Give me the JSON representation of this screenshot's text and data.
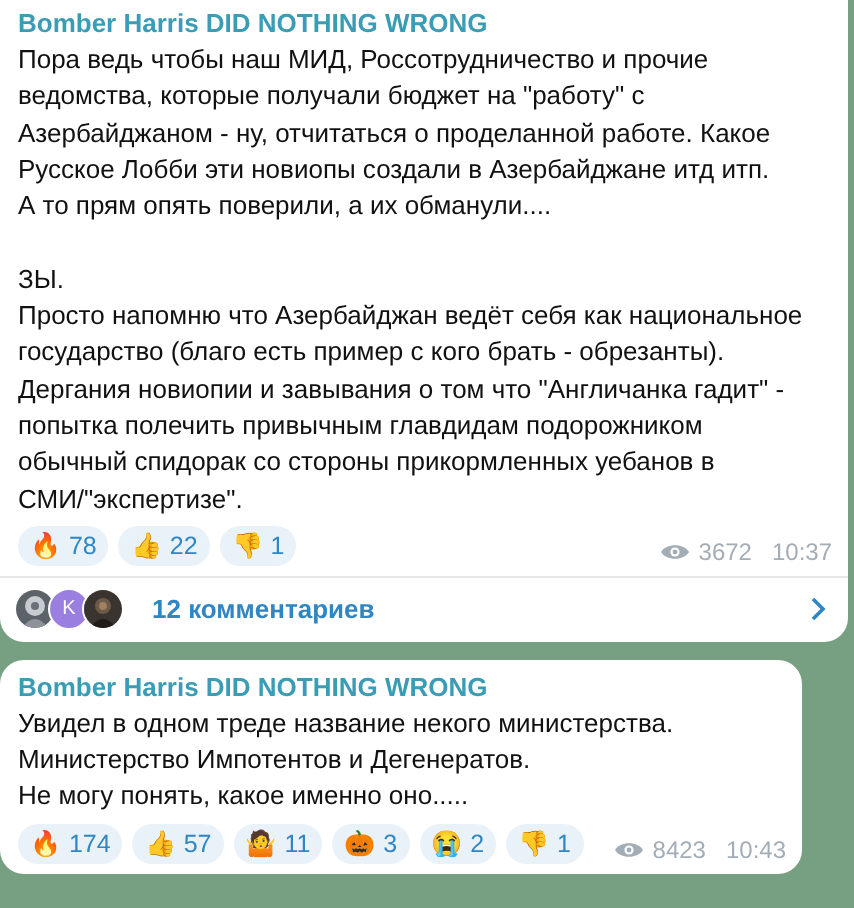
{
  "posts": [
    {
      "channel": "Bomber Harris DID NOTHING WRONG",
      "paragraphs": [
        [
          "Пора ведь чтобы наш МИД, Россотрудничество и прочие",
          "ведомства, которые получали бюджет на \"работу\" с",
          "Азербайджаном - ну, отчитаться о проделанной работе. Какое",
          "Русское Лобби эти новиопы создали в Азербайджане итд итп.",
          "А то прям опять поверили, а их обманули...."
        ],
        [
          "ЗЫ.",
          "Просто напомню что Азербайджан ведёт себя как национальное",
          "государство (благо есть пример с кого брать - обрезанты).",
          "Дергания новиопии и завывания о том что \"Англичанка гадит\" -",
          "попытка полечить привычным главдидам подорожником",
          "обычный спидорак со стороны прикормленных уебанов в",
          "СМИ/\"экспертизе\"."
        ]
      ],
      "reactions": [
        {
          "emoji": "🔥",
          "count": "78"
        },
        {
          "emoji": "👍",
          "count": "22"
        },
        {
          "emoji": "👎",
          "count": "1"
        }
      ],
      "views": "3672",
      "time": "10:37",
      "comments": {
        "avatars": [
          {
            "kind": "picture"
          },
          {
            "kind": "letter",
            "letter": "K",
            "color": "#9b7fe0"
          },
          {
            "kind": "picture"
          }
        ],
        "label": "12 комментариев"
      }
    },
    {
      "channel": "Bomber Harris DID NOTHING WRONG",
      "paragraphs": [
        [
          "Увидел в одном треде название некого министерства.",
          "Министерство Импотентов и Дегенератов.",
          "Не могу понять, какое именно оно....."
        ]
      ],
      "reactions": [
        {
          "emoji": "🔥",
          "count": "174"
        },
        {
          "emoji": "👍",
          "count": "57"
        },
        {
          "emoji": "🤷",
          "count": "11"
        },
        {
          "emoji": "🎃",
          "count": "3"
        },
        {
          "emoji": "😭",
          "count": "2"
        },
        {
          "emoji": "👎",
          "count": "1"
        }
      ],
      "views": "8423",
      "time": "10:43"
    }
  ]
}
